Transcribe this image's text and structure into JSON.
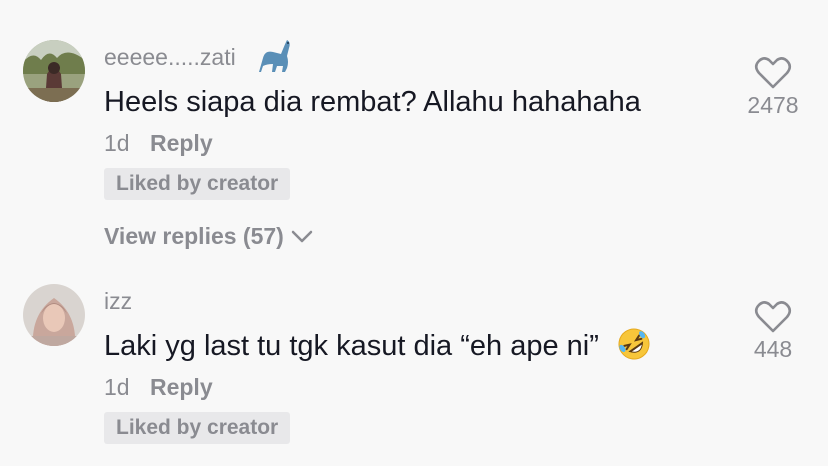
{
  "comments": [
    {
      "username": "eeeee.....zati",
      "username_emoji": "dinosaur-icon",
      "text": "Heels siapa dia rembat? Allahu hahahaha",
      "time": "1d",
      "reply_label": "Reply",
      "liked_by_creator": "Liked by creator",
      "view_replies": "View replies (57)",
      "likes": "2478"
    },
    {
      "username": "izz",
      "text": "Laki yg last tu tgk kasut dia “eh ape ni”",
      "text_emoji": "rolling-on-floor-laughing-icon",
      "time": "1d",
      "reply_label": "Reply",
      "liked_by_creator": "Liked by creator",
      "likes": "448"
    }
  ],
  "colors": {
    "background": "#f8f8f8",
    "primary_text": "#161823",
    "secondary_text": "#8a8b91",
    "badge_bg": "#e8e8ea"
  }
}
